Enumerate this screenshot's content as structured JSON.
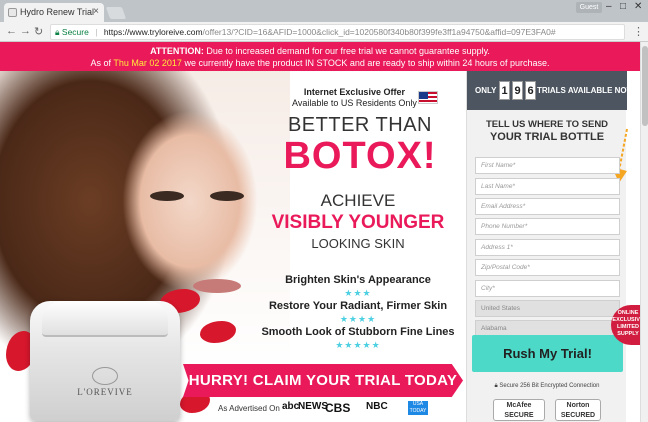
{
  "browser": {
    "tab_title": "Hydro Renew Trial",
    "tab_close": "×",
    "guest_label": "Guest",
    "secure_label": "Secure",
    "url_host": "https://www.tryloreive.com",
    "url_rest": "/offer13/?CID=16&AFID=1000&click_id=1020580f340b80f399fe3ff1a94750&affid=097E3FA0#",
    "icons": {
      "back": "back-arrow-icon",
      "forward": "forward-arrow-icon",
      "reload": "reload-icon",
      "lock": "lock-icon",
      "menu": "kebab-menu-icon"
    }
  },
  "banner": {
    "attention": "ATTENTION:",
    "line1_rest": " Due to increased demand for our free trial we cannot guarantee supply.",
    "line2_prefix": "As of ",
    "date": "Thu Mar 02 2017",
    "line2_rest": " we currently have the product IN STOCK and are ready to ship within 24 hours of purchase.",
    "color": "#e9195a"
  },
  "hero": {
    "exclusive_title": "Internet Exclusive Offer",
    "exclusive_sub": "Available to US Residents Only",
    "better_than": "BETTER THAN",
    "botox": "BOTOX!",
    "achieve": "ACHIEVE",
    "visibly_younger": "VISIBLY YOUNGER",
    "looking_skin": "LOOKING SKIN",
    "benefits": [
      {
        "text": "Brighten Skin's Appearance",
        "stars": "★★★"
      },
      {
        "text": "Restore Your Radiant, Firmer Skin",
        "stars": "★★★★"
      },
      {
        "text": "Smooth Look of Stubborn Fine Lines",
        "stars": "★★★★★"
      }
    ],
    "hurry": "HURRY! CLAIM YOUR TRIAL TODAY",
    "jar_brand": "L'OREVIVE",
    "advertised": "As Advertised On",
    "logos": [
      "abc",
      "NEWS",
      "CBS",
      "NBC",
      "USA TODAY"
    ],
    "usa_text": "USA TODAY"
  },
  "form": {
    "only": "ONLY",
    "digits": [
      "1",
      "9",
      "6"
    ],
    "trials": "TRIALS AVAILABLE NOW!",
    "tell_line1": "TELL US WHERE TO SEND",
    "tell_line2": "YOUR TRIAL BOTTLE",
    "fields": [
      "First Name*",
      "Last Name*",
      "Email Address*",
      "Phone Number*",
      "Address 1*",
      "Zip/Postal Code*",
      "City*"
    ],
    "country": "United States",
    "state": "Alabama",
    "submit": "Rush My Trial!",
    "secure_note": "Secure 256 Bit Encrypted Connection",
    "badge_mcafee": "McAfee SECURE",
    "badge_norton": "Norton SECURED",
    "online_tag": "ONLINE EXCLUSIVE LIMITED SUPPLY",
    "accent": "#4dd9c8",
    "arrow_color": "#f5a623"
  }
}
